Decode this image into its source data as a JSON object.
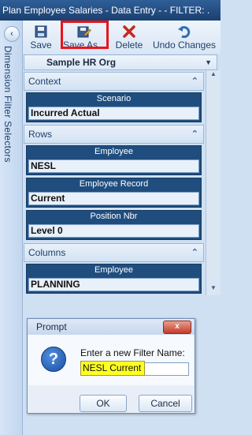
{
  "window": {
    "title": "Plan Employee Salaries - Data Entry -  - FILTER: ."
  },
  "side_panel": {
    "label": "Dimension Filter Selectors"
  },
  "toolbar": {
    "save_label": "Save",
    "save_as_label": "Save As...",
    "delete_label": "Delete",
    "undo_label": "Undo Changes"
  },
  "org": {
    "name": "Sample HR Org"
  },
  "sections": {
    "context": "Context",
    "rows": "Rows",
    "columns": "Columns"
  },
  "fields": [
    {
      "label": "Scenario",
      "value": "Incurred Actual"
    },
    {
      "label": "Employee",
      "value": "NESL"
    },
    {
      "label": "Employee Record",
      "value": "Current"
    },
    {
      "label": "Position Nbr",
      "value": "Level 0"
    },
    {
      "label": "Employee",
      "value": "PLANNING"
    }
  ],
  "dialog": {
    "title": "Prompt",
    "close_label": "x",
    "message": "Enter a new Filter Name:",
    "input_value": "NESL Current",
    "ok_label": "OK",
    "cancel_label": "Cancel"
  },
  "colors": {
    "highlight": "#e8141b",
    "field_header": "#1f4e7e",
    "selection": "#ffff22"
  }
}
